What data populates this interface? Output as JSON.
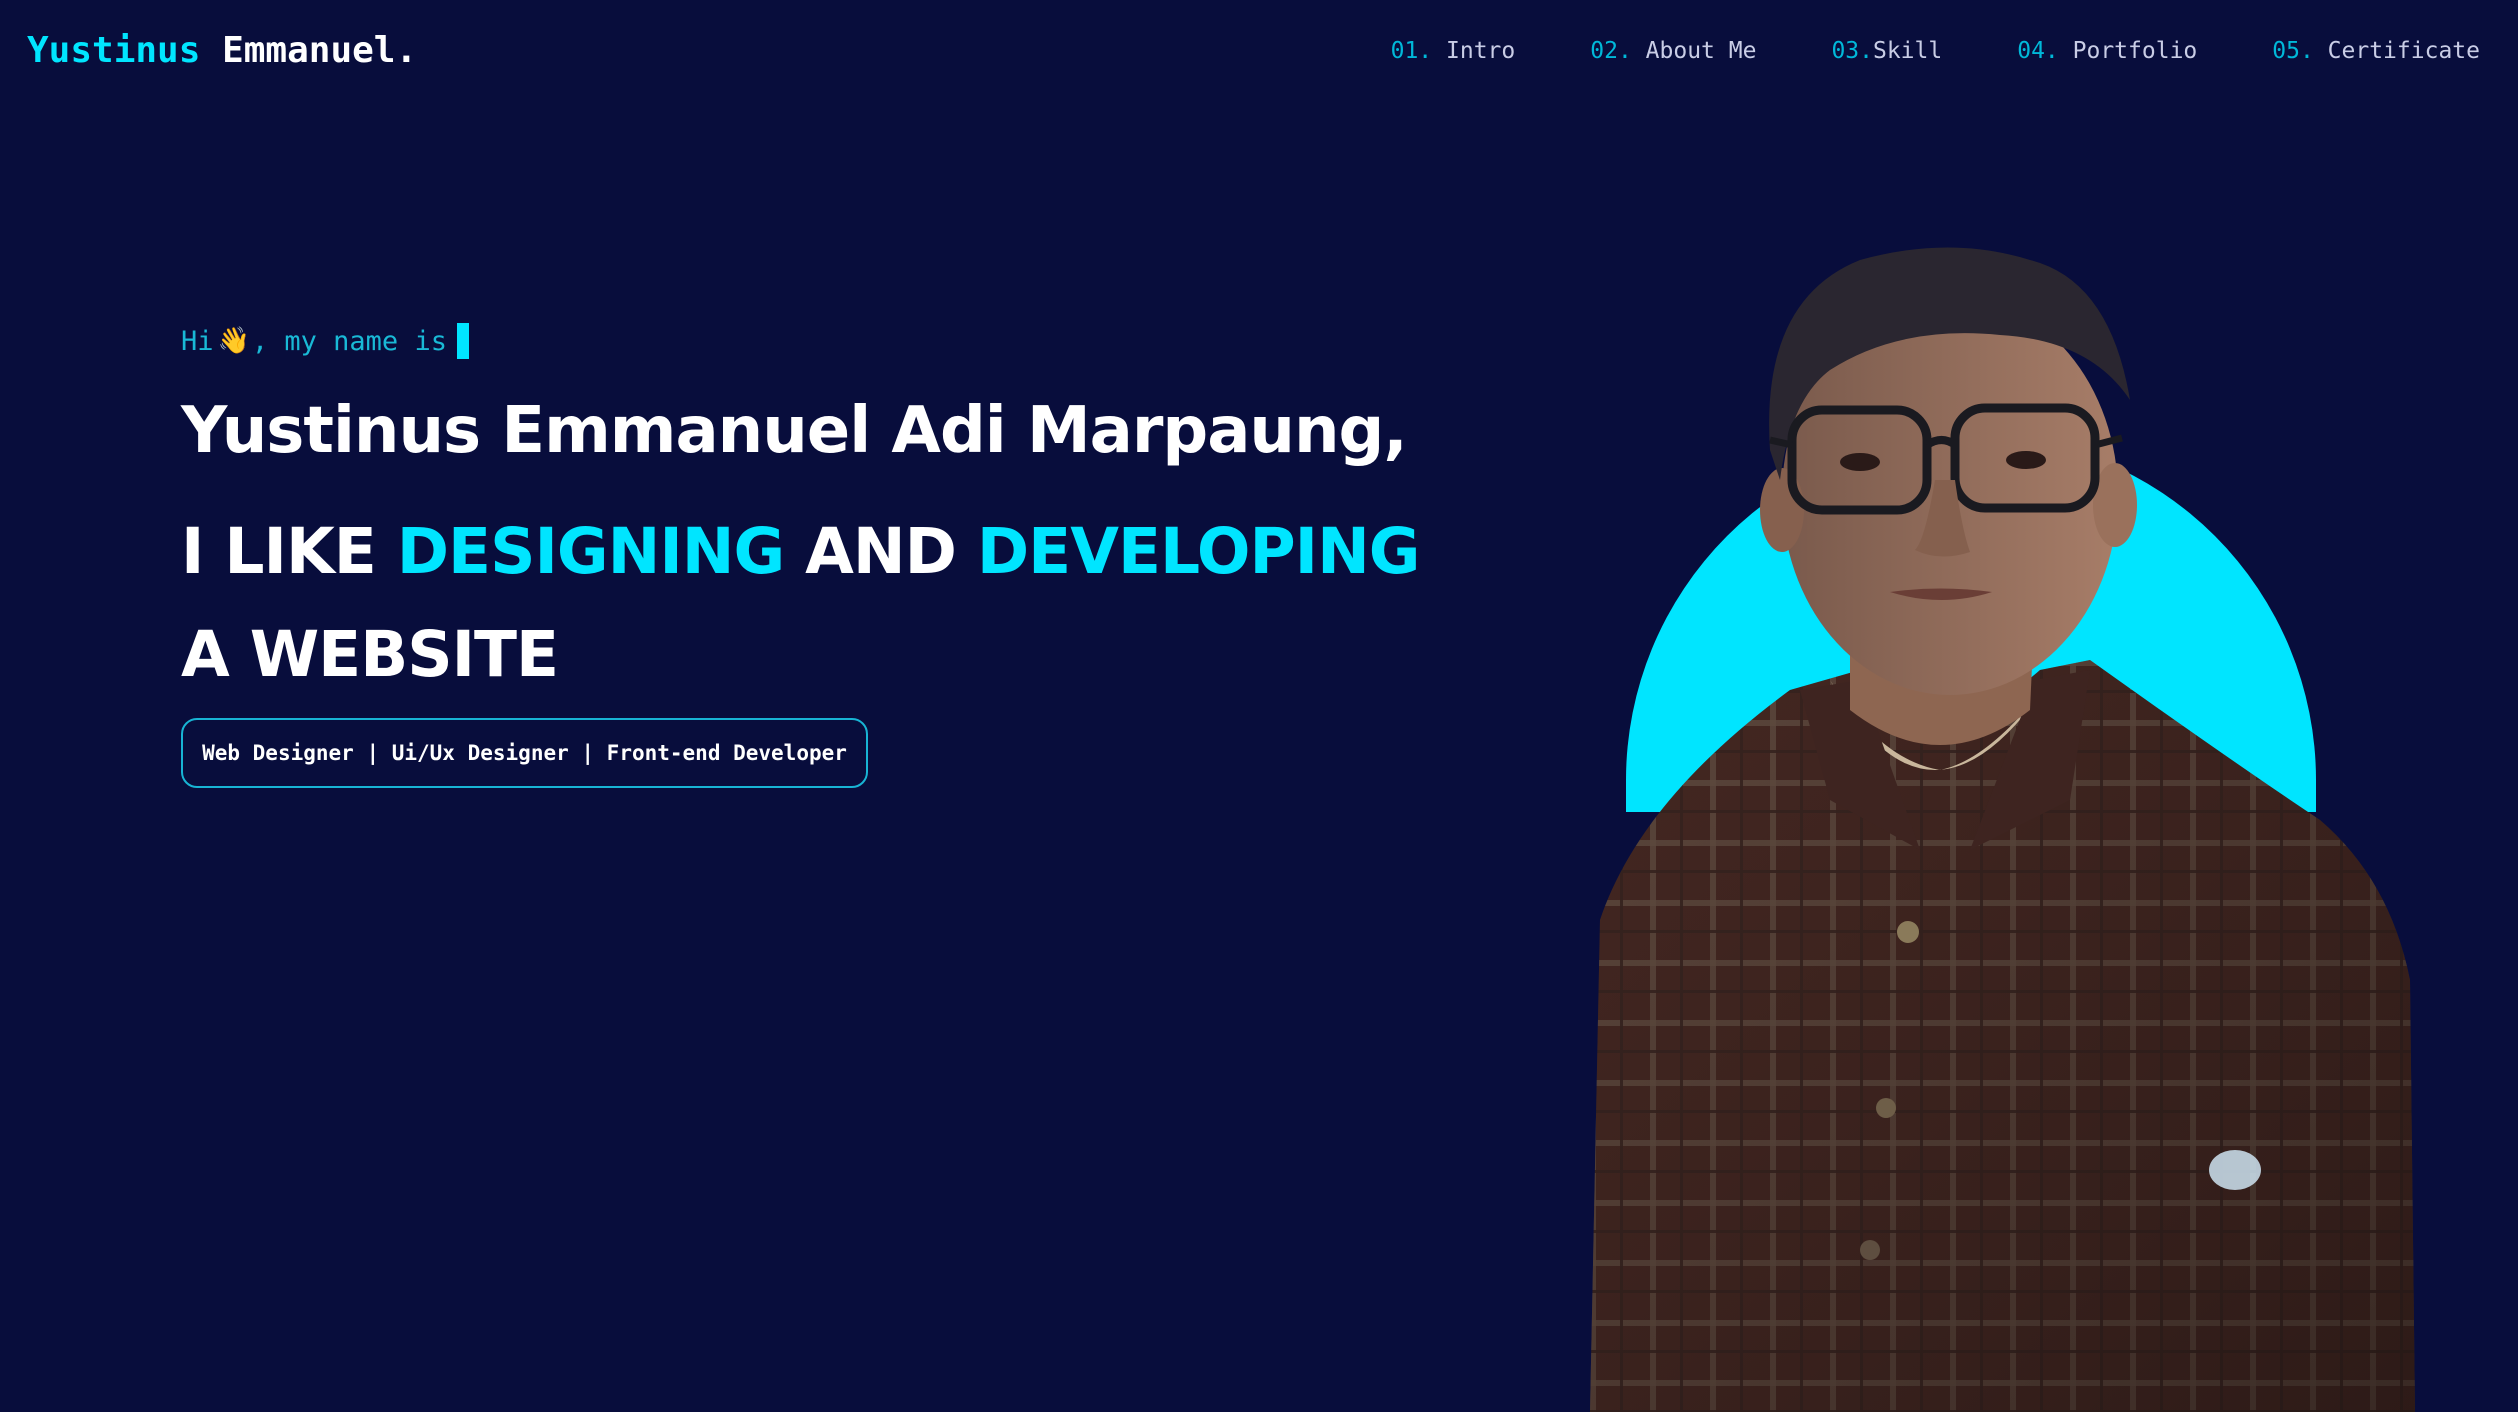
{
  "header": {
    "logo_first": "Yustinus",
    "logo_last": "Emmanuel."
  },
  "nav": [
    {
      "num": "01.",
      "label": "Intro"
    },
    {
      "num": "02.",
      "label": "About Me"
    },
    {
      "num": "03.",
      "label": "Skill"
    },
    {
      "num": "04.",
      "label": "Portfolio"
    },
    {
      "num": "05.",
      "label": "Certificate"
    }
  ],
  "hero": {
    "greeting_before": "Hi",
    "wave": "👋",
    "greeting_after": ", my name is",
    "name": "Yustinus Emmanuel Adi Marpaung,",
    "tagline_1": "I LIKE ",
    "tagline_2": "DESIGNING",
    "tagline_3": " AND ",
    "tagline_4": "DEVELOPING",
    "tagline_5": " A WEBSITE",
    "roles": "Web Designer | Ui/Ux Designer | Front-end Developer"
  },
  "colors": {
    "background": "#080d3c",
    "accent": "#00e5ff",
    "text": "#ffffff"
  },
  "icons": {
    "portrait": "profile-photo"
  }
}
